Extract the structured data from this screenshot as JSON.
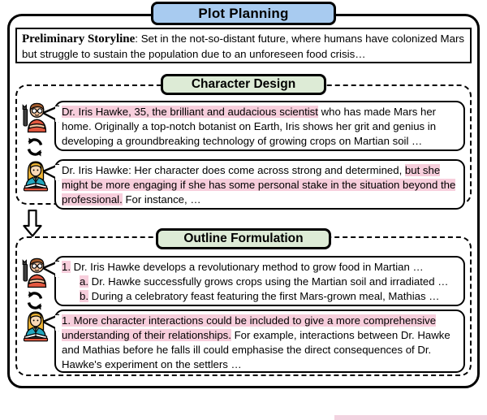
{
  "figure": {
    "title": "Plot Planning",
    "title_badge_color": "#a8cbf0",
    "section_badge_color": "#ddebd6",
    "highlight_color": "#f7cedc",
    "border_color": "#000000"
  },
  "storyline": {
    "label": "Preliminary Storyline",
    "separator": ": ",
    "text": "Set in the not-so-distant future, where humans have colonized Mars but struggle to sustain the population due to an unforeseen food crisis…"
  },
  "sections": [
    {
      "id": "character-design",
      "badge": "Character Design",
      "messages": [
        {
          "role": "writer",
          "avatar": "engineer-avatar",
          "parts": [
            {
              "text": "Dr. Iris Hawke, 35, the brilliant and audacious scientist",
              "highlight": true
            },
            {
              "text": " who has made Mars her home. Originally a top-notch botanist on Earth, Iris shows her grit and genius in developing a groundbreaking technology of growing crops on Martian soil …",
              "highlight": false
            }
          ]
        },
        {
          "role": "critic",
          "avatar": "teacher-avatar",
          "parts": [
            {
              "text": "Dr. Iris Hawke: Her character does come across strong and determined, ",
              "highlight": false
            },
            {
              "text": "but she might be more engaging if she has some personal stake in the situation beyond the professional.",
              "highlight": true
            },
            {
              "text": " For instance, …",
              "highlight": false
            }
          ]
        }
      ]
    },
    {
      "id": "outline-formulation",
      "badge": "Outline Formulation",
      "messages": [
        {
          "role": "writer",
          "avatar": "engineer-avatar",
          "list": [
            {
              "marker": "1.",
              "text": " Dr. Iris Hawke develops a revolutionary method to grow food in Martian …",
              "indent": 0
            },
            {
              "marker": "a.",
              "text": " Dr. Hawke successfully grows crops using the Martian soil and irradiated …",
              "indent": 1
            },
            {
              "marker": "b.",
              "text": " During a celebratory feast featuring the first Mars-grown meal, Mathias …",
              "indent": 1
            }
          ]
        },
        {
          "role": "critic",
          "avatar": "teacher-avatar",
          "parts": [
            {
              "text": "1. More character interactions could be included to give a more comprehensive understanding of their relationships.",
              "highlight": true
            },
            {
              "text": " For example, interactions between Dr. Hawke and Mathias before he falls ill could emphasise the direct consequences of Dr. Hawke's experiment on the settlers …",
              "highlight": false
            }
          ]
        }
      ]
    }
  ],
  "icons": {
    "refresh": "refresh-loop-icon",
    "flow_arrow": "down-arrow-icon"
  }
}
